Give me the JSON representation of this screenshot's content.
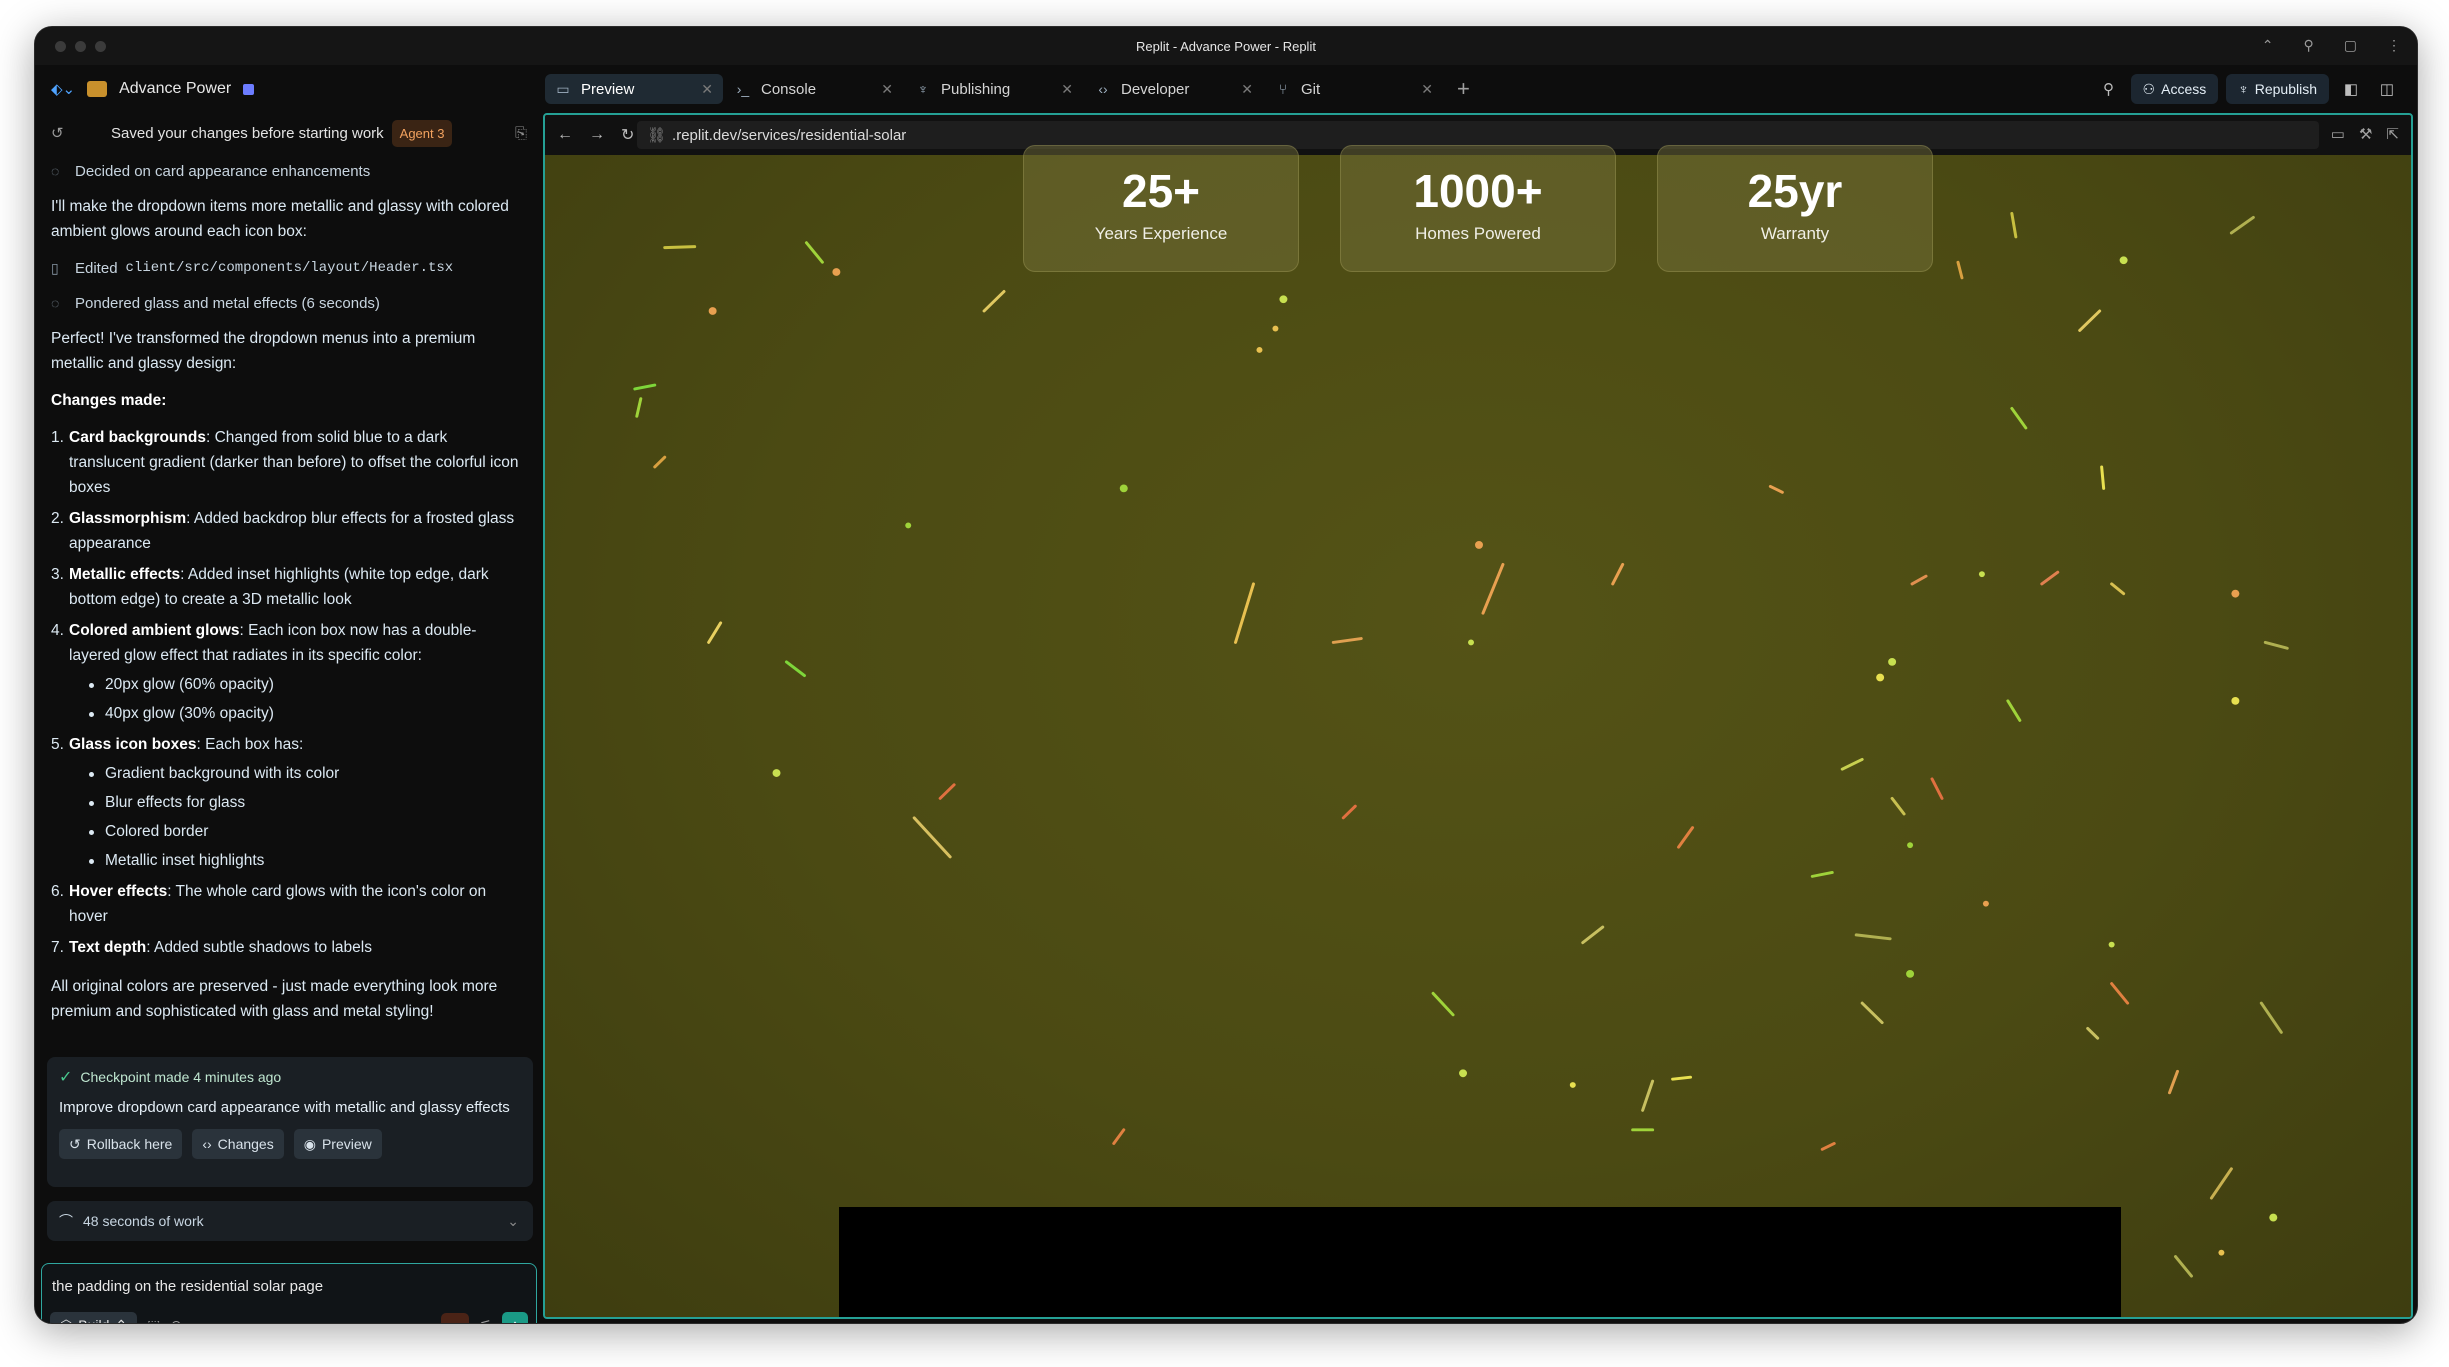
{
  "window": {
    "title": "Replit - Advance Power - Replit"
  },
  "project": {
    "name": "Advance Power"
  },
  "tabs": [
    {
      "label": "Preview",
      "icon": "monitor-icon"
    },
    {
      "label": "Console",
      "icon": "terminal-icon"
    },
    {
      "label": "Publishing",
      "icon": "publish-icon"
    },
    {
      "label": "Developer",
      "icon": "code-icon"
    },
    {
      "label": "Git",
      "icon": "git-icon"
    }
  ],
  "topbar": {
    "access_label": "Access",
    "republish_label": "Republish"
  },
  "chat": {
    "saved_text": "Saved your changes before starting work",
    "agent_badge": "Agent 3",
    "step1": "Decided on card appearance enhancements",
    "intro": "I'll make the dropdown items more metallic and glassy with colored ambient glows around each icon box:",
    "edited_prefix": "Edited",
    "edited_file": "client/src/components/layout/Header.tsx",
    "step2": "Pondered glass and metal effects (6 seconds)",
    "summary": "Perfect! I've transformed the dropdown menus into a premium metallic and glassy design:",
    "changes_heading": "Changes made:",
    "changes": [
      {
        "num": "1.",
        "title": "Card backgrounds",
        "text": ": Changed from solid blue to a dark translucent gradient (darker than before) to offset the colorful icon boxes",
        "sub": []
      },
      {
        "num": "2.",
        "title": "Glassmorphism",
        "text": ": Added backdrop blur effects for a frosted glass appearance",
        "sub": []
      },
      {
        "num": "3.",
        "title": "Metallic effects",
        "text": ": Added inset highlights (white top edge, dark bottom edge) to create a 3D metallic look",
        "sub": []
      },
      {
        "num": "4.",
        "title": "Colored ambient glows",
        "text": ": Each icon box now has a double-layered glow effect that radiates in its specific color:",
        "sub": [
          "20px glow (60% opacity)",
          "40px glow (30% opacity)"
        ]
      },
      {
        "num": "5.",
        "title": "Glass icon boxes",
        "text": ": Each box has:",
        "sub": [
          "Gradient background with its color",
          "Blur effects for glass",
          "Colored border",
          "Metallic inset highlights"
        ]
      },
      {
        "num": "6.",
        "title": "Hover effects",
        "text": ": The whole card glows with the icon's color on hover",
        "sub": []
      },
      {
        "num": "7.",
        "title": "Text depth",
        "text": ": Added subtle shadows to labels",
        "sub": []
      }
    ],
    "closing": "All original colors are preserved - just made everything look more premium and sophisticated with glass and metal styling!",
    "checkpoint": {
      "made": "Checkpoint made 4 minutes ago",
      "desc": "Improve dropdown card appearance with metallic and glassy effects",
      "rollback": "Rollback here",
      "changes": "Changes",
      "preview": "Preview"
    },
    "work": "48 seconds of work",
    "input_value": "the padding on the residential solar page",
    "build_label": "Build"
  },
  "preview": {
    "url": ".replit.dev/services/residential-solar",
    "stats": [
      {
        "value": "25+",
        "label": "Years Experience"
      },
      {
        "value": "1000+",
        "label": "Homes Powered"
      },
      {
        "value": "25yr",
        "label": "Warranty"
      }
    ]
  }
}
